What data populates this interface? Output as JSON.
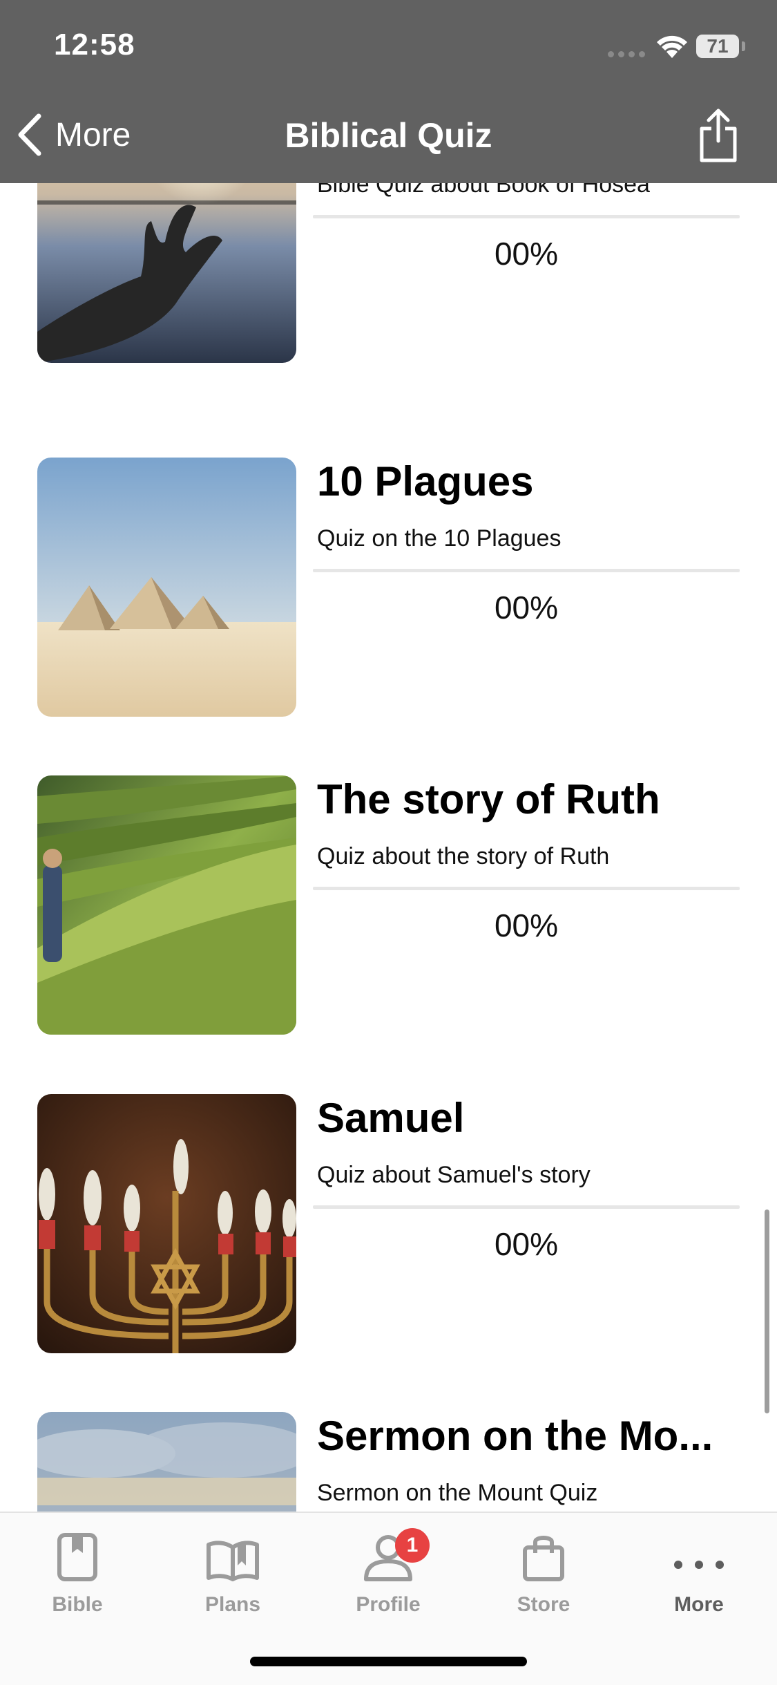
{
  "status_bar": {
    "time": "12:58",
    "battery": "71"
  },
  "nav": {
    "back_label": "More",
    "title": "Biblical Quiz"
  },
  "items": [
    {
      "title": "",
      "subtitle": "Bible Quiz about Book of Hosea",
      "progress": "00%",
      "image": "hand-sunlight-image"
    },
    {
      "title": "10 Plagues",
      "subtitle": "Quiz on the 10 Plagues",
      "progress": "00%",
      "image": "pyramids-image"
    },
    {
      "title": "The story of Ruth",
      "subtitle": "Quiz about the story of Ruth",
      "progress": "00%",
      "image": "wheat-field-image"
    },
    {
      "title": "Samuel",
      "subtitle": "Quiz about Samuel's story",
      "progress": "00%",
      "image": "menorah-image"
    },
    {
      "title": "Sermon on the Mo...",
      "subtitle": "Sermon on the Mount Quiz",
      "progress": "",
      "image": "clouds-sky-image"
    }
  ],
  "tabs": [
    {
      "label": "Bible",
      "icon": "bible-icon"
    },
    {
      "label": "Plans",
      "icon": "open-book-icon"
    },
    {
      "label": "Profile",
      "icon": "person-icon",
      "badge": "1"
    },
    {
      "label": "Store",
      "icon": "shopping-bag-icon"
    },
    {
      "label": "More",
      "icon": "more-dots-icon"
    }
  ],
  "colors": {
    "header": "#616161",
    "badge": "#e74242",
    "tab_inactive": "#9b9b9b",
    "tab_active": "#5d5d5d"
  }
}
